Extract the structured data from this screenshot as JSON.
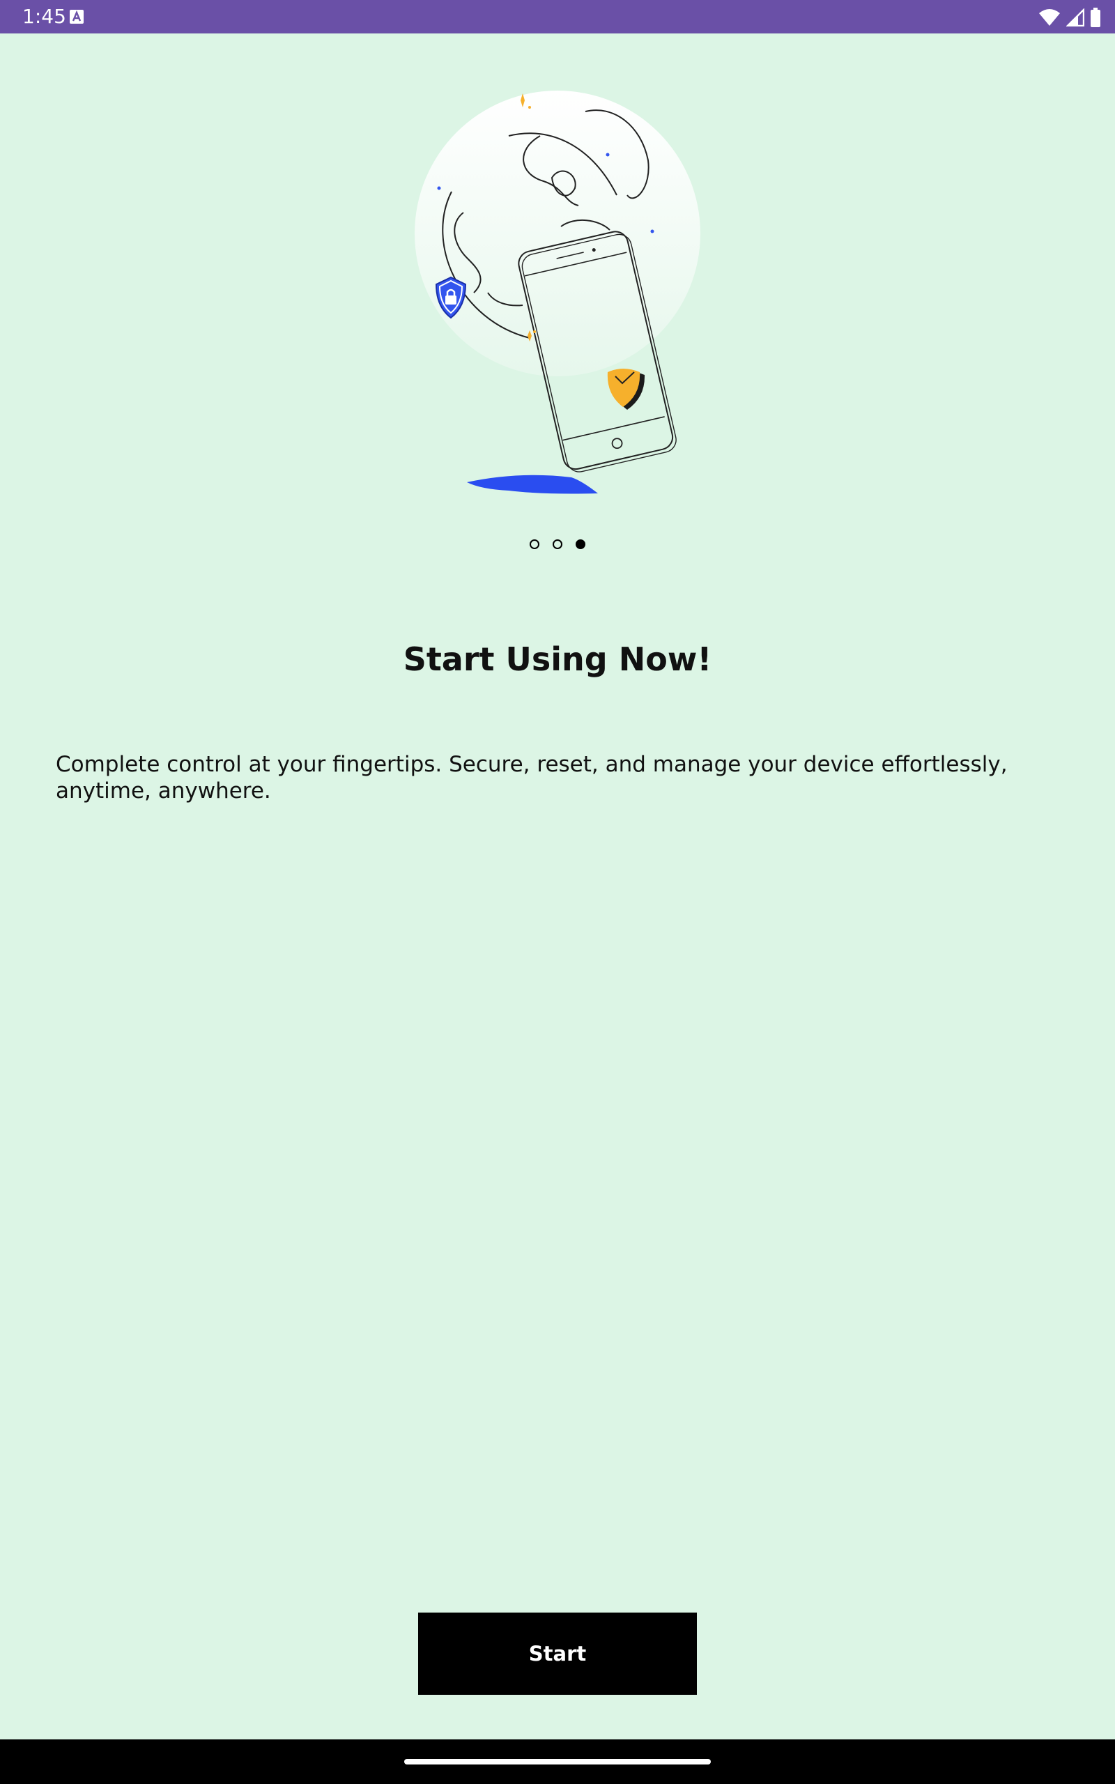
{
  "status_bar": {
    "time": "1:45",
    "icons": [
      "a-notification-icon",
      "wifi-icon",
      "signal-icon",
      "battery-icon"
    ]
  },
  "onboarding": {
    "illustration": "phone-globe-security-illustration",
    "pager": {
      "total": 3,
      "active_index": 2
    },
    "title": "Start Using Now!",
    "description": "Complete control at your fingertips. Secure, reset, and manage your device effortlessly, anytime, anywhere.",
    "start_label": "Start"
  },
  "colors": {
    "background": "#DCF5E5",
    "status_bar": "#6A50A7",
    "button": "#000000",
    "shield_blue": "#3355EE",
    "shield_yellow": "#F6B02C"
  }
}
